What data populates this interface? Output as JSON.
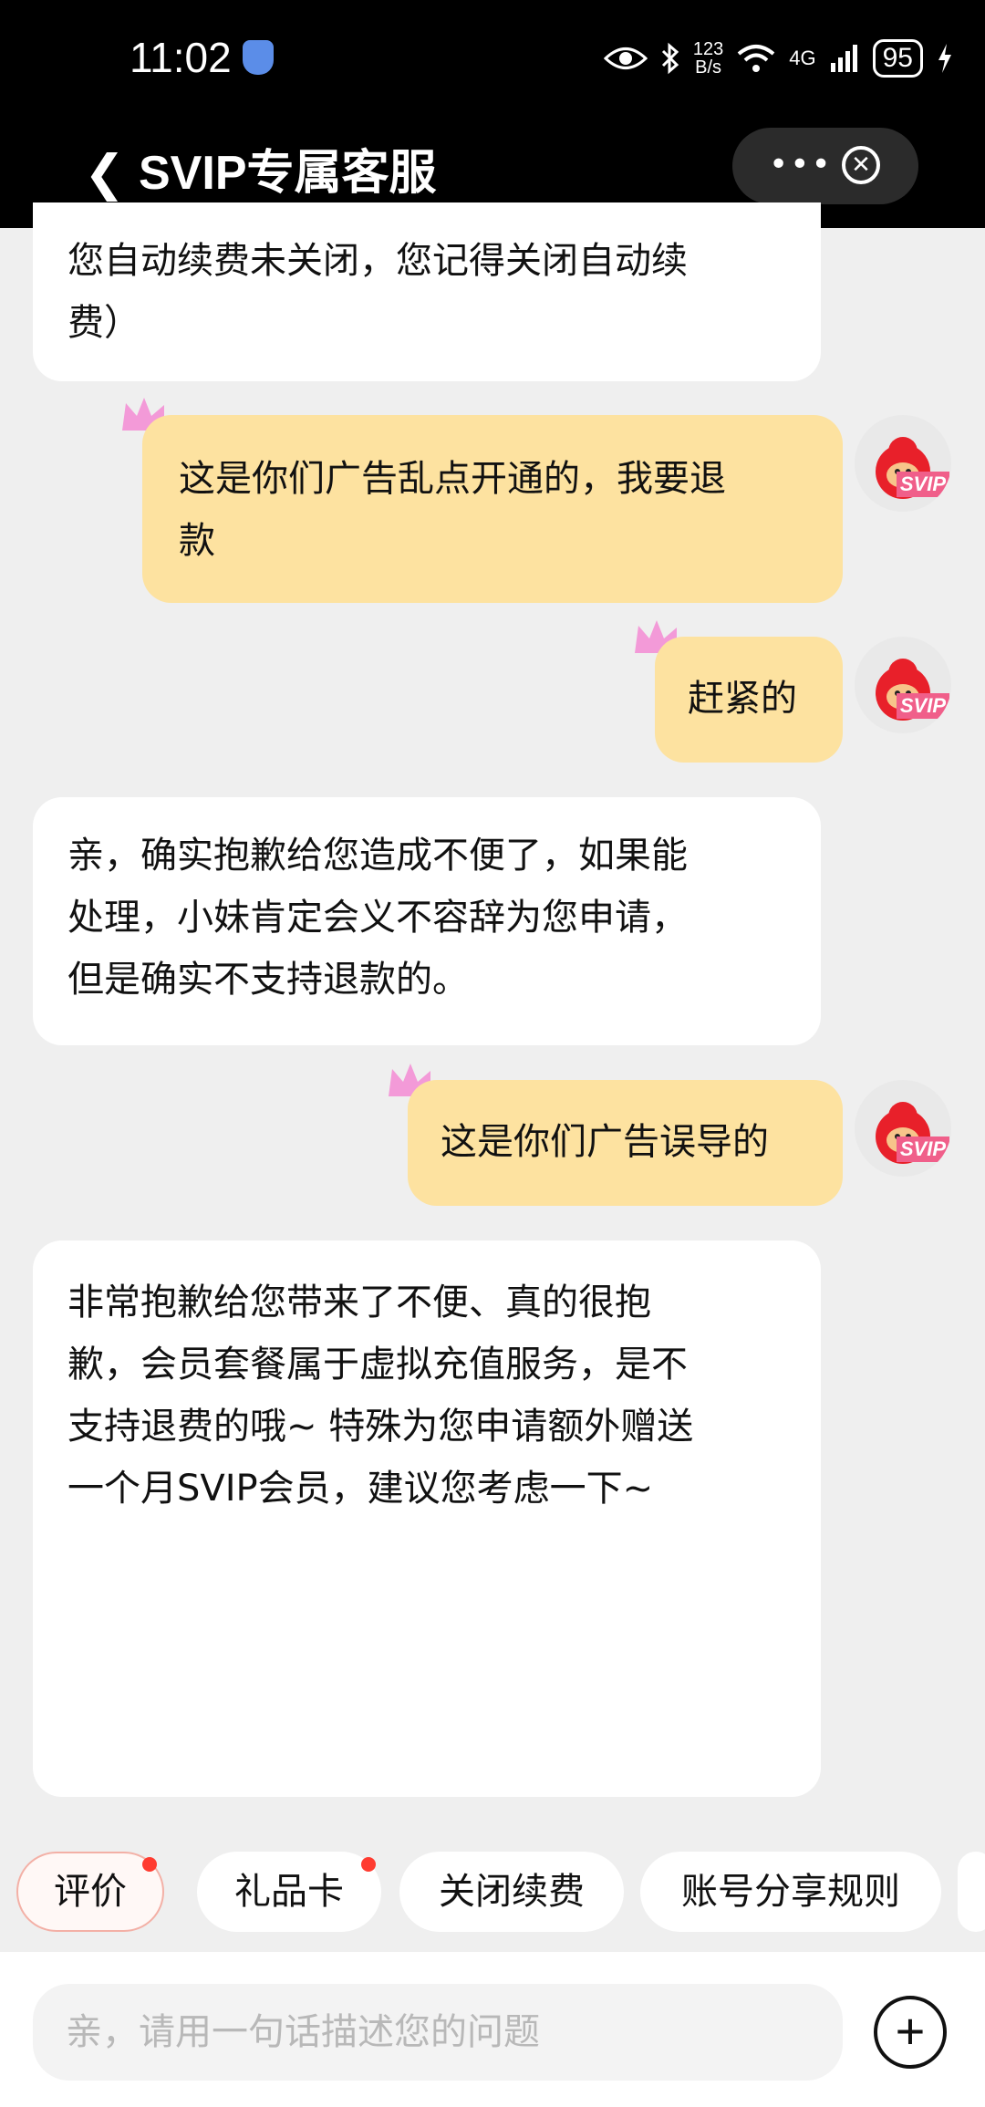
{
  "status_bar": {
    "time": "11:02",
    "net_speed_top": "123",
    "net_speed_bottom": "B/s",
    "network_type": "4G",
    "battery": "95"
  },
  "header": {
    "title": "SVIP专属客服",
    "more_icon": "more-icon",
    "close_icon": "close-icon"
  },
  "messages": [
    {
      "side": "agent",
      "text": "您自动续费未关闭，您记得关闭自动续\n费）"
    },
    {
      "side": "user",
      "text": "这是你们广告乱点开通的，我要退\n款"
    },
    {
      "side": "user",
      "text": "赶紧的"
    },
    {
      "side": "agent",
      "text": "亲，确实抱歉给您造成不便了，如果能\n处理，小妹肯定会义不容辞为您申请，\n但是确实不支持退款的。"
    },
    {
      "side": "user",
      "text": "这是你们广告误导的"
    },
    {
      "side": "agent",
      "text": "非常抱歉给您带来了不便、真的很抱\n歉，会员套餐属于虚拟充值服务，是不\n支持退费的哦~ 特殊为您申请额外赠送\n一个月SVIP会员，建议您考虑一下~"
    }
  ],
  "avatar_badge": "SVIP",
  "quick_tags": [
    "评价",
    "礼品卡",
    "关闭续费",
    "账号分享规则"
  ],
  "input": {
    "placeholder": "亲，请用一句话描述您的问题",
    "value": ""
  },
  "colors": {
    "user_bubble": "#fde2a0",
    "agent_bubble": "#ffffff",
    "background": "#efefef",
    "accent_red": "#ff3b30"
  }
}
